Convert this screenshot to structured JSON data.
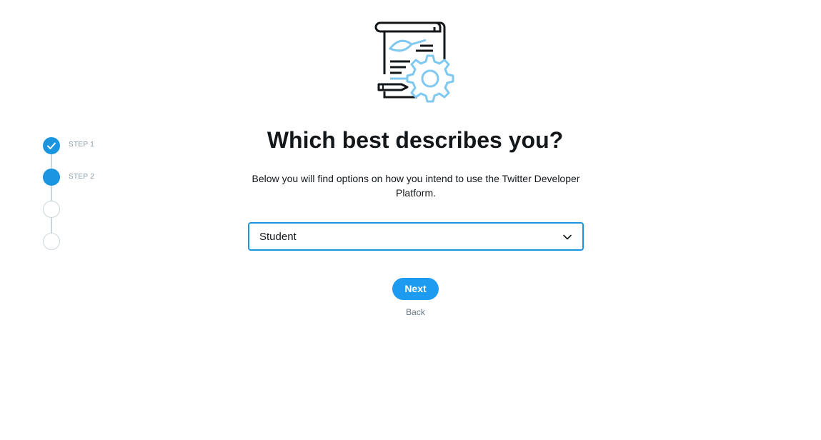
{
  "stepper": {
    "steps": [
      {
        "label": "STEP 1",
        "status": "complete",
        "icon": "check-icon"
      },
      {
        "label": "STEP 2",
        "status": "active"
      },
      {
        "label": "",
        "status": "pending"
      },
      {
        "label": "",
        "status": "pending"
      }
    ]
  },
  "illustration": {
    "icon": "document-gear-illustration"
  },
  "main": {
    "title": "Which best describes you?",
    "subtitle": "Below you will find options on how you intend to use the Twitter Developer Platform.",
    "select": {
      "value": "Student",
      "icon": "chevron-down-icon"
    },
    "next_label": "Next",
    "back_label": "Back"
  },
  "colors": {
    "accent": "#1d9bf0",
    "text": "#14171a",
    "muted": "#657786",
    "step_label": "#8899a6",
    "line": "#ccd6dd",
    "illustration_light": "#7fc8f0"
  }
}
